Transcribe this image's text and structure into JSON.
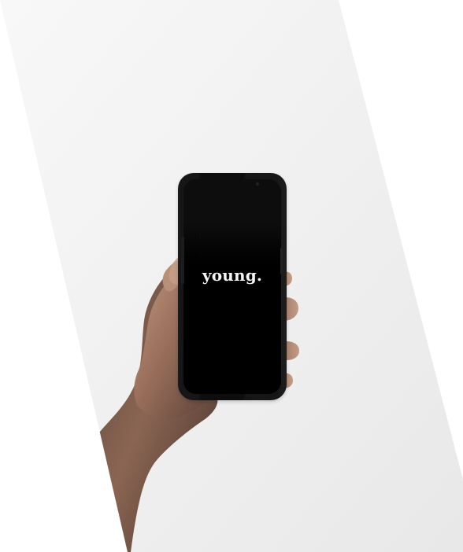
{
  "image": {
    "screen_logo_text": "young.",
    "icons": {
      "photo": "photo-icon",
      "phone": "smartphone-icon",
      "hand": "hand-icon"
    },
    "colors": {
      "page_background": "#ffffff",
      "photo_background_top": "#f7f7f7",
      "photo_background_bottom": "#e9e9e9",
      "phone_body": "#0c0c0c",
      "phone_screen": "#050505",
      "logo_text": "#f5f5f5",
      "skin_light": "#b88f75",
      "skin_mid": "#8e6754",
      "skin_dark": "#4f3a30"
    }
  }
}
